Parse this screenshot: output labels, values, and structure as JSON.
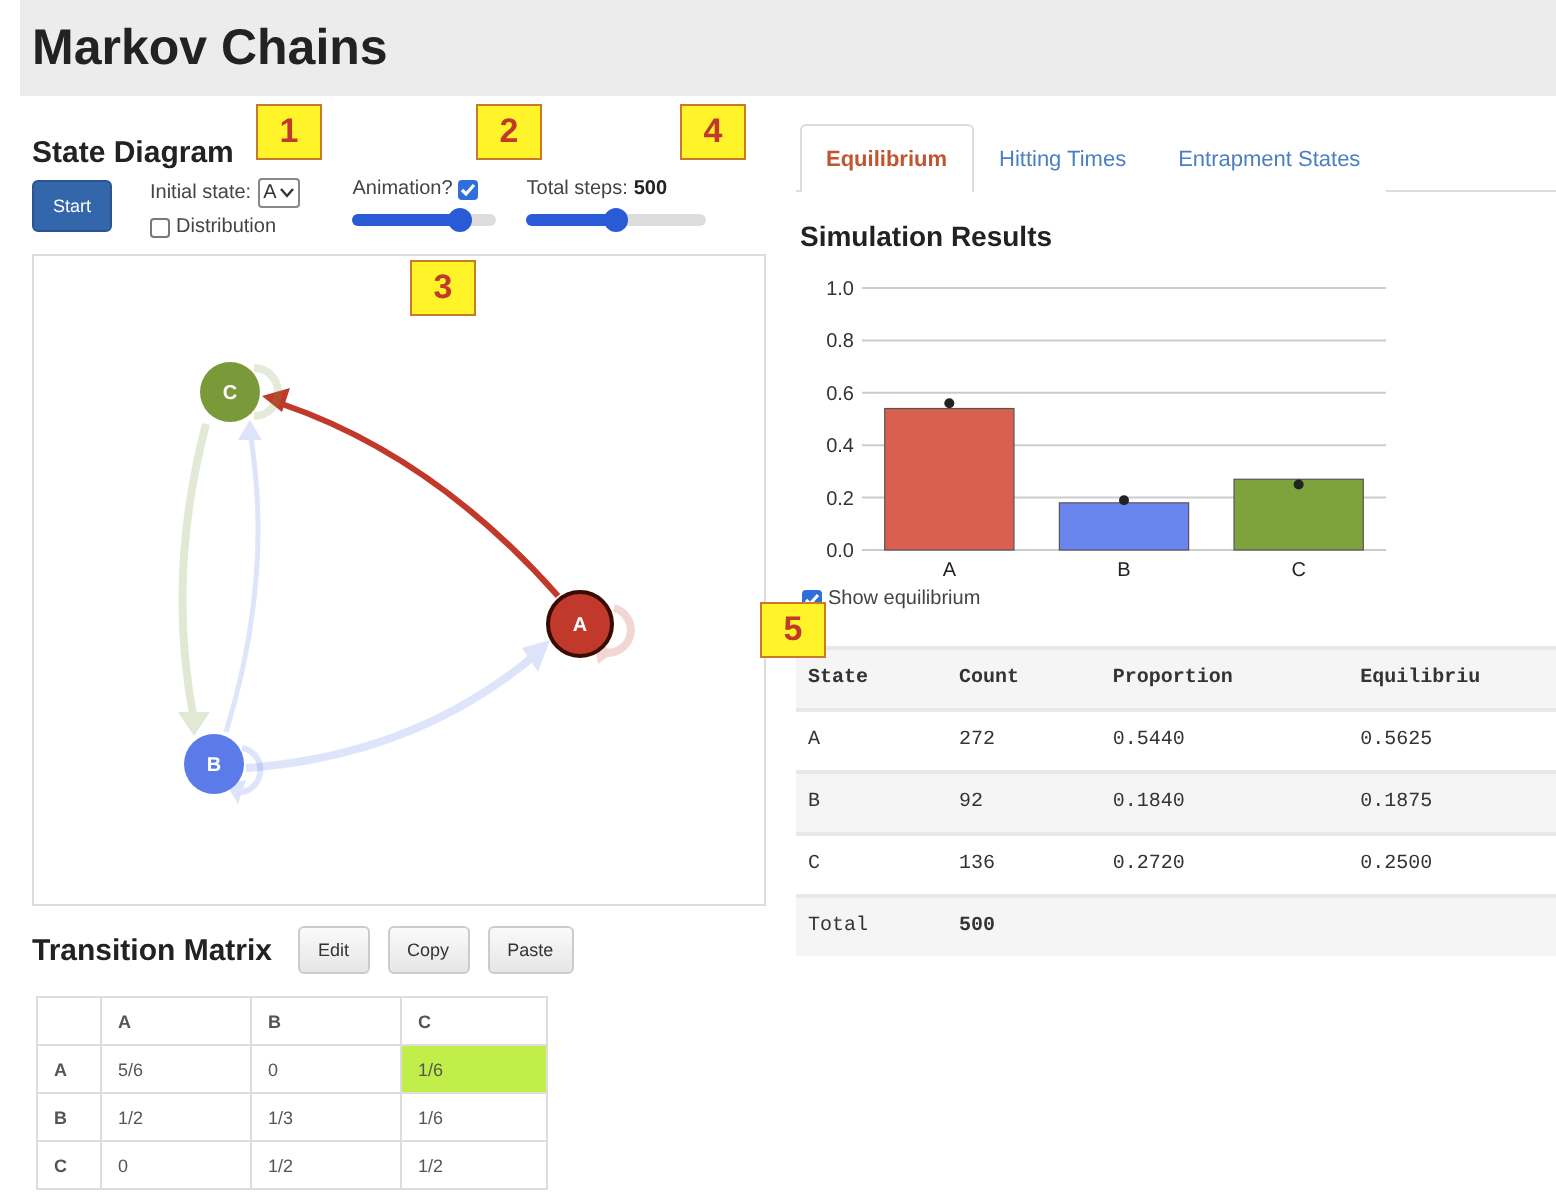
{
  "title": "Markov Chains",
  "callouts": [
    {
      "label": "1"
    },
    {
      "label": "2"
    },
    {
      "label": "3"
    },
    {
      "label": "4"
    },
    {
      "label": "5"
    }
  ],
  "state_diagram": {
    "title": "State Diagram",
    "start_button": "Start",
    "initial_state": {
      "label": "Initial state:",
      "value": "A"
    },
    "distribution": {
      "label": "Distribution",
      "checked": false
    },
    "animation": {
      "label": "Animation?",
      "checked": true,
      "level": 0.75
    },
    "total_steps": {
      "label": "Total steps:",
      "value": "500",
      "level": 0.5
    },
    "nodes": [
      {
        "label": "A",
        "color": "#c0392b",
        "selected": true
      },
      {
        "label": "B",
        "color": "#5b7be8",
        "selected": false
      },
      {
        "label": "C",
        "color": "#7a9a3a",
        "selected": false
      }
    ]
  },
  "transition_matrix": {
    "title": "Transition Matrix",
    "buttons": [
      "Edit",
      "Copy",
      "Paste"
    ],
    "columns": [
      "A",
      "B",
      "C"
    ],
    "rows": [
      {
        "label": "A",
        "cells": [
          {
            "value": "5/6",
            "selected": false
          },
          {
            "value": "0",
            "selected": false
          },
          {
            "value": "1/6",
            "selected": true
          }
        ]
      },
      {
        "label": "B",
        "cells": [
          {
            "value": "1/2",
            "selected": false
          },
          {
            "value": "1/3",
            "selected": false
          },
          {
            "value": "1/6",
            "selected": false
          }
        ]
      },
      {
        "label": "C",
        "cells": [
          {
            "value": "0",
            "selected": false
          },
          {
            "value": "1/2",
            "selected": false
          },
          {
            "value": "1/2",
            "selected": false
          }
        ]
      }
    ]
  },
  "tabs": [
    {
      "label": "Equilibrium",
      "selected": true
    },
    {
      "label": "Hitting Times",
      "selected": false
    },
    {
      "label": "Entrapment States",
      "selected": false
    }
  ],
  "results": {
    "title": "Simulation Results",
    "chart_data": {
      "type": "bar",
      "categories": [
        "A",
        "B",
        "C"
      ],
      "series": [
        {
          "colors": [
            "#d9604f",
            "#6b85ee",
            "#7ea23c"
          ],
          "values": [
            0.54,
            0.18,
            0.27
          ]
        },
        {
          "type": "scatter",
          "color": "#222222",
          "values": [
            0.56,
            0.19,
            0.25
          ]
        }
      ],
      "ylim": [
        0,
        1
      ],
      "grid": true,
      "yticks": [
        {
          "value": 0,
          "label": "0.0"
        },
        {
          "value": 0.2,
          "label": "0.2"
        },
        {
          "value": 0.4,
          "label": "0.4"
        },
        {
          "value": 0.6,
          "label": "0.6"
        },
        {
          "value": 0.8,
          "label": "0.8"
        },
        {
          "value": 1,
          "label": "1.0"
        }
      ]
    },
    "show_equilibrium": {
      "label": "Show equilibrium",
      "checked": true
    },
    "table": {
      "columns": [
        "State",
        "Count",
        "Proportion",
        "Equilibriu"
      ],
      "rows": [
        [
          "A",
          "272",
          "0.5440",
          "0.5625"
        ],
        [
          "B",
          "92",
          "0.1840",
          "0.1875"
        ],
        [
          "C",
          "136",
          "0.2720",
          "0.2500"
        ]
      ],
      "total": [
        "Total",
        "500"
      ]
    }
  }
}
